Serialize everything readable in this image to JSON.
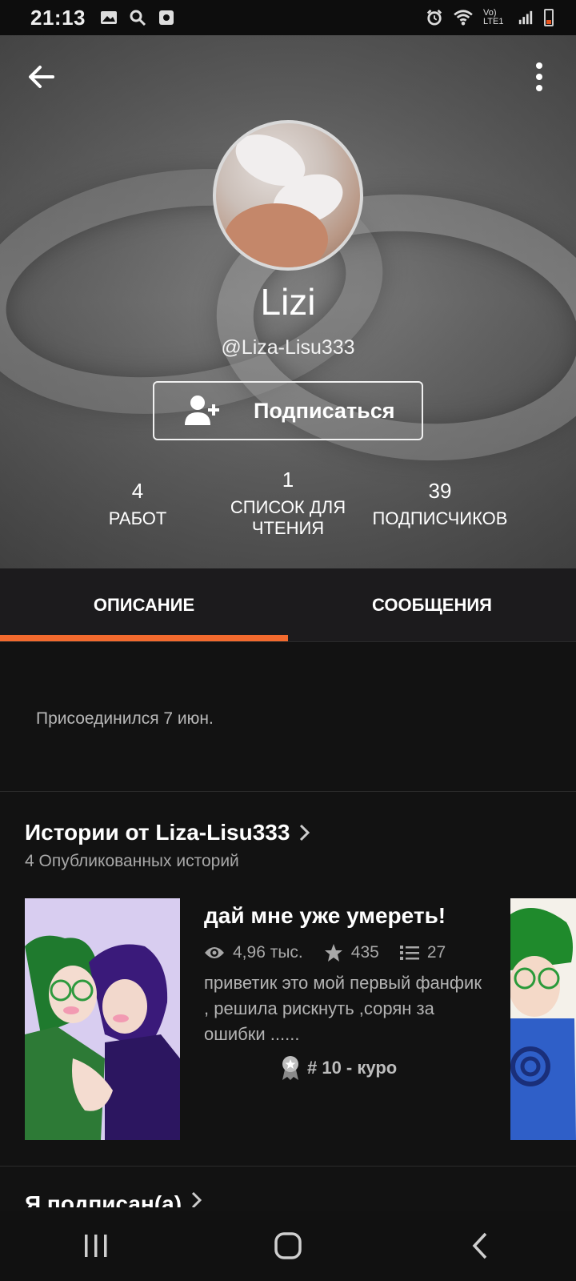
{
  "status_bar": {
    "time": "21:13",
    "left_icons": [
      "gallery-icon",
      "search-icon",
      "screen-record-icon"
    ],
    "right_icons": [
      "alarm-icon",
      "wifi-icon",
      "volte-icon",
      "signal-icon",
      "battery-icon"
    ],
    "network_label": "Vo) LTE1"
  },
  "profile": {
    "name": "Lizi",
    "handle": "@Liza-Lisu333",
    "follow_label": "Подписаться",
    "stats": [
      {
        "value": "4",
        "label": "РАБОТ"
      },
      {
        "value": "1",
        "label": "СПИСОК ДЛЯ ЧТЕНИЯ"
      },
      {
        "value": "39",
        "label": "ПОДПИСЧИКОВ"
      }
    ]
  },
  "tabs": [
    {
      "label": "ОПИСАНИЕ",
      "active": true
    },
    {
      "label": "СООБЩЕНИЯ",
      "active": false
    }
  ],
  "about": {
    "joined": "Присоединился 7 июн."
  },
  "stories_section": {
    "title": "Истории от Liza-Lisu333",
    "subtitle": "4 Опубликованных историй",
    "stories": [
      {
        "title": "дай мне уже умереть!",
        "reads": "4,96 тыс.",
        "votes": "435",
        "parts": "27",
        "description": "приветик это мой первый фанфик , решила рискнуть ,сорян за ошибки ......",
        "rank": "# 10 - куро"
      }
    ]
  },
  "following_section": {
    "title": "Я подписан(а)"
  },
  "colors": {
    "accent": "#f26a2e",
    "background": "#121212",
    "tab_bar": "#1c1b1d"
  }
}
